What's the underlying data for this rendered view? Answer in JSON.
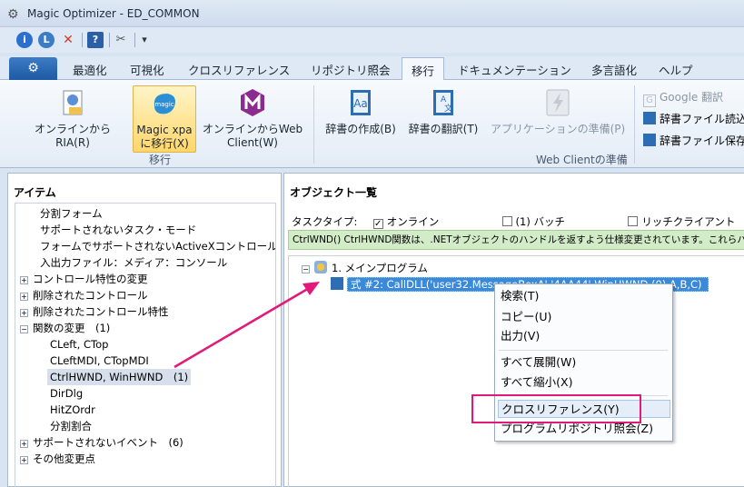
{
  "window": {
    "title": "Magic Optimizer - ED_COMMON"
  },
  "qat": {
    "info": "i",
    "l4": "L",
    "close": "✕",
    "book": "?",
    "tools": "✂",
    "dropdown": "▾"
  },
  "tabs": [
    "最適化",
    "可視化",
    "クロスリファレンス",
    "リポジトリ照会",
    "移行",
    "ドキュメンテーション",
    "多言語化",
    "ヘルプ"
  ],
  "ribbon": {
    "btn_ria": "オンラインからRIA(R)",
    "btn_xpa_line1": "Magic xpa",
    "btn_xpa_line2": "に移行(X)",
    "xpa_logo": "magic",
    "btn_web_line1": "オンラインからWeb",
    "btn_web_line2": "Client(W)",
    "group_migrate": "移行",
    "btn_dict_create": "辞書の作成(B)",
    "btn_dict_translate": "辞書の翻訳(T)",
    "btn_app_prepare": "アプリケーションの準備(P)",
    "group_webclient": "Web Clientの準備",
    "cmd_google": "Google 翻訳",
    "cmd_dict_load": "辞書ファイル読込",
    "cmd_dict_save": "辞書ファイル保存"
  },
  "left": {
    "title": "アイテム",
    "expand_plus": "+",
    "expand_minus": "−",
    "items": [
      "分割フォーム",
      "サポートされないタスク・モード",
      "フォームでサポートされないActiveXコントロール",
      "入出力ファイル：メディア：コンソール",
      "コントロール特性の変更",
      "削除されたコントロール",
      "削除されたコントロール特性",
      "関数の変更　(1)",
      "CLeft, CTop",
      "CLeftMDI, CTopMDI",
      "CtrlHWND, WinHWND　(1)",
      "DirDlg",
      "HitZOrdr",
      "分割割合",
      "サポートされないイベント　(6)",
      "その他変更点"
    ]
  },
  "right": {
    "title": "オブジェクト一覧",
    "task_type_label": "タスクタイプ:",
    "opt_online": "オンライン",
    "opt_batch": "(1) バッチ",
    "opt_rich": "リッチクライアント",
    "check_mark": "✓",
    "notice": "CtrlWND() CtrlHWND関数は、.NETオブジェクトのハンドルを返すよう仕様変更されています。これらハンドルは、FromHandl",
    "node_main": "1. メインプログラム",
    "node_expr": "式 #2: CallDLL('user32.MessageBoxA','4AA44',WinHWND (0),A,B,C)"
  },
  "menu": {
    "items": [
      "検索(T)",
      "コピー(U)",
      "出力(V)",
      "すべて展開(W)",
      "すべて縮小(X)",
      "クロスリファレンス(Y)",
      "プログラムリポジトリ照会(Z)"
    ]
  },
  "colors": {
    "accent": "#e2187b",
    "file_tab": "#2a66b1",
    "selection": "#3b8ad9",
    "notice": "#d3ecc8"
  }
}
